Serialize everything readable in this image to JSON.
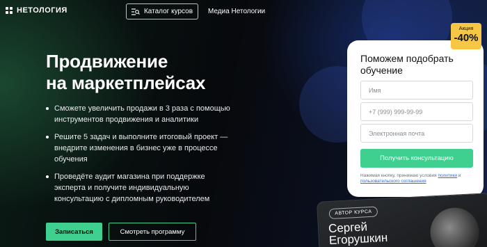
{
  "header": {
    "logo_text": "НЕТОЛОГИЯ",
    "catalog_label": "Каталог курсов",
    "media_label": "Медиа Нетологии"
  },
  "hero": {
    "title_line1": "Продвижение",
    "title_line2": "на маркетплейсах",
    "benefits": [
      "Сможете увеличить продажи в 3 раза с помощью инструментов продвижения и аналитики",
      "Решите 5 задач и выполните итоговый проект — внедрите изменения в бизнес уже в процессе обучения",
      "Проведёте аудит магазина при поддержке эксперта и получите индивидуальную консультацию с дипломным руководителем"
    ],
    "enroll_label": "Записаться",
    "program_label": "Смотреть программу"
  },
  "promo": {
    "label": "Акция",
    "value": "-40%"
  },
  "form": {
    "title": "Поможем подобрать обучение",
    "name_placeholder": "Имя",
    "phone_placeholder": "+7 (999) 999-99-99",
    "email_placeholder": "Электронная почта",
    "submit_label": "Получить консультацию",
    "consent_text": "Нажимая кнопку, принимаю условия ",
    "consent_link1": "политики",
    "consent_and": " и ",
    "consent_link2": "пользовательского соглашения"
  },
  "author": {
    "tag": "АВТОР КУРСА",
    "name": "Сергей Егорушкин"
  },
  "colors": {
    "accent": "#3fcf8e",
    "promo": "#f6c744"
  }
}
